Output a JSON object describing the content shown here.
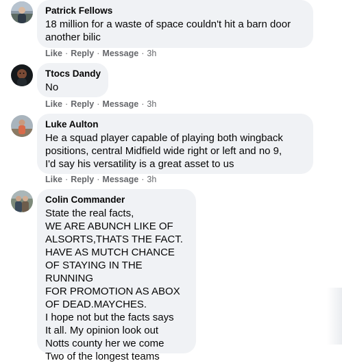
{
  "comments": [
    {
      "author": "Patrick Fellows",
      "text": "18 million for a waste of space couldn't hit a barn door\nanother bilic",
      "actions": {
        "like": "Like",
        "reply": "Reply",
        "message": "Message",
        "time": "3h"
      }
    },
    {
      "author": "Ttocs Dandy",
      "text": "No",
      "actions": {
        "like": "Like",
        "reply": "Reply",
        "message": "Message",
        "time": "3h"
      }
    },
    {
      "author": "Luke Aulton",
      "text": "He a squad player capable of playing both wingback\npositions, central Midfield wide right or left and no 9,\nI'd say his versatility is a great asset to us",
      "actions": {
        "like": "Like",
        "reply": "Reply",
        "message": "Message",
        "time": "3h"
      }
    },
    {
      "author": "Colin Commander",
      "text": "State the real facts,\nWE ARE ABUNCH LIKE OF\nALSORTS,THATS THE FACT.\nHAVE AS MUTCH CHANCE\nOF STAYING IN THE RUNNING\nFOR PROMOTION AS ABOX\nOF DEAD.MAYCHES.\nI hope not but the facts says\nIt all. My opinion look out\nNotts county her we come\nTwo of the longest teams"
    }
  ],
  "separator": "·",
  "colors": {
    "bubble": "#f0f2f5",
    "text": "#050505",
    "meta": "#65676b"
  }
}
